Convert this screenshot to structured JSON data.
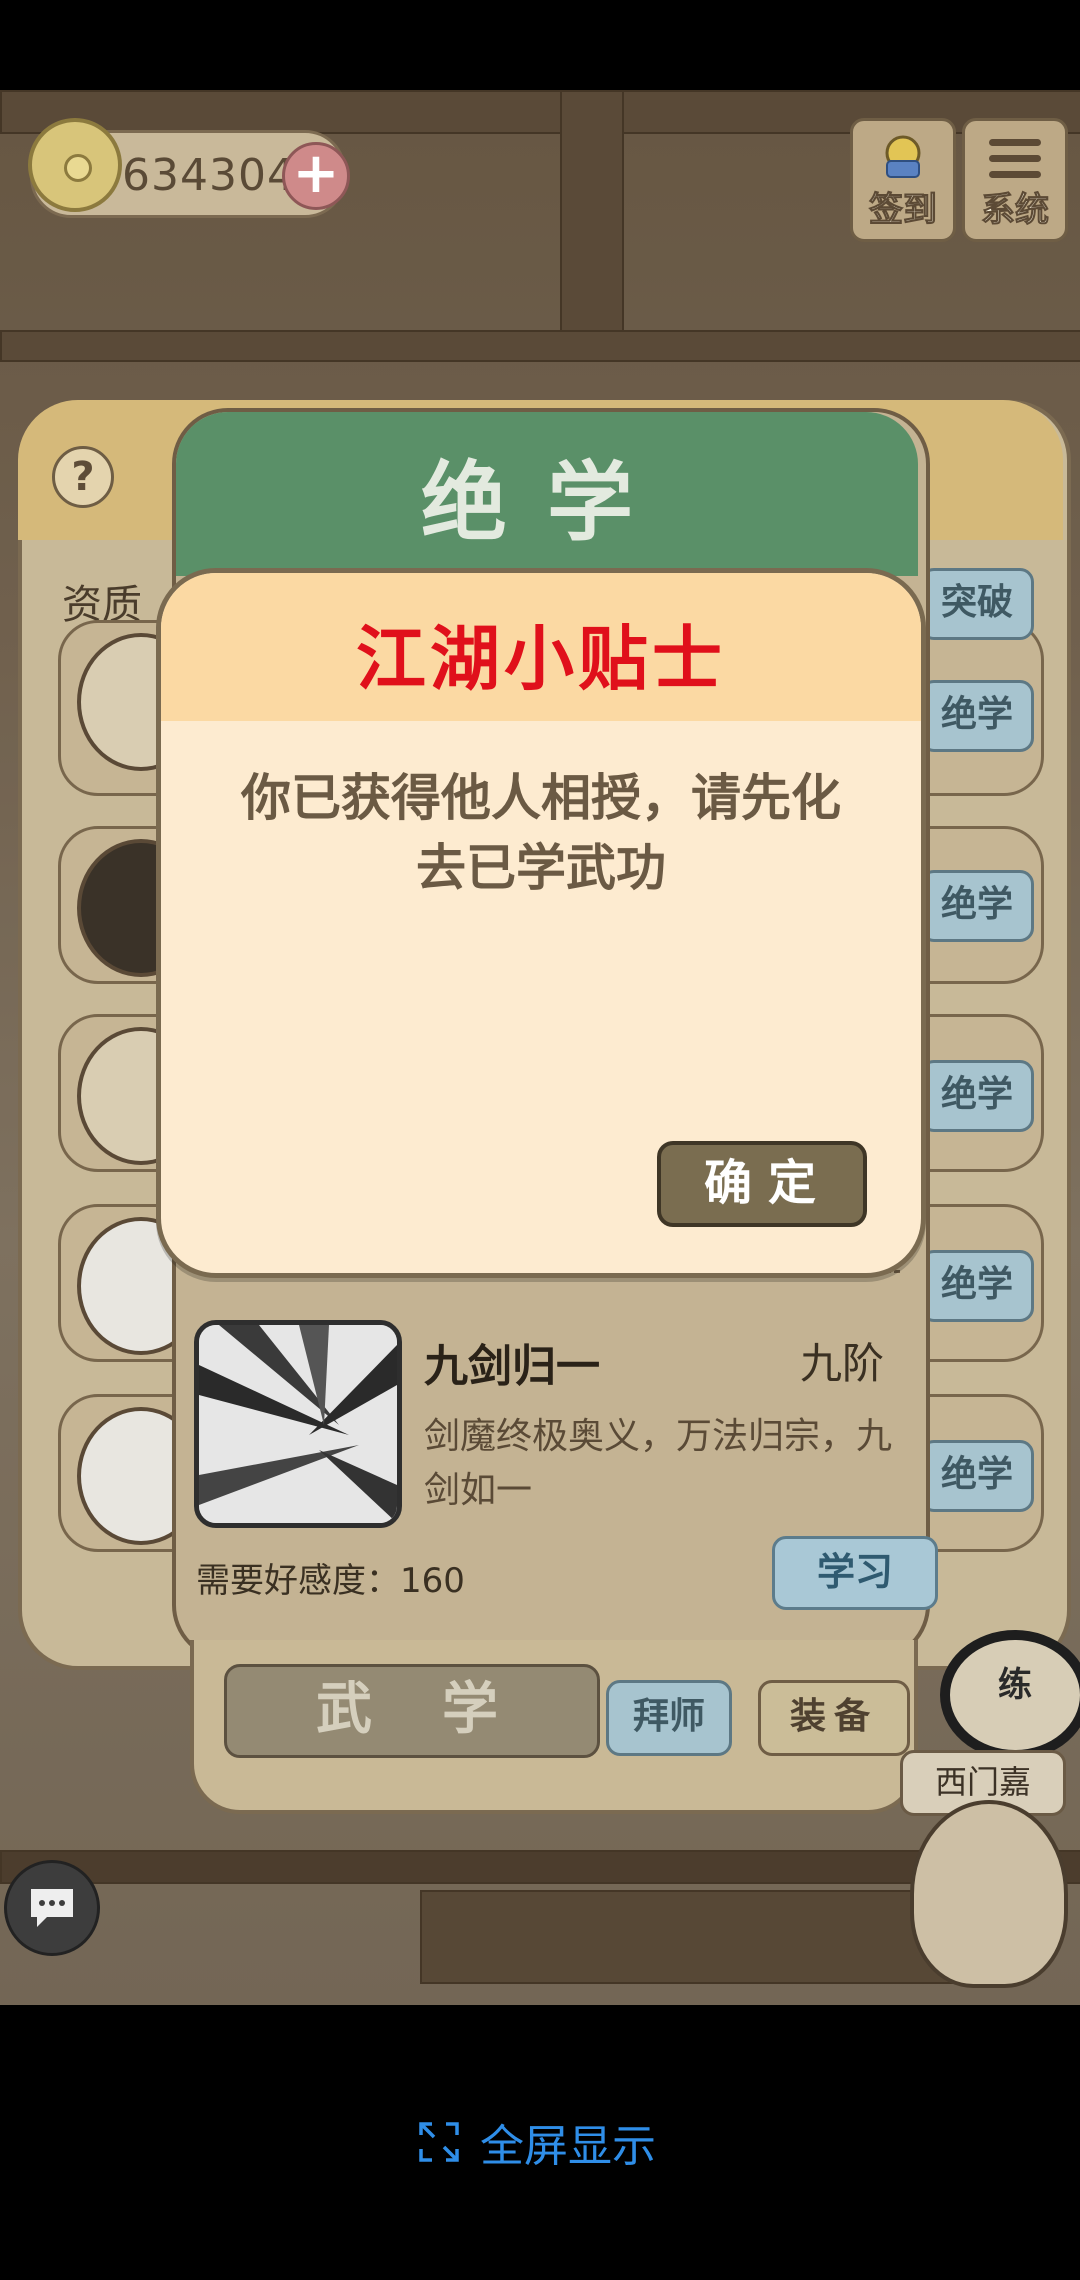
{
  "hud": {
    "coins": "634304",
    "plus_symbol": "+",
    "signin_label": "签到",
    "system_label": "系统"
  },
  "back_panel": {
    "help_symbol": "?",
    "quality_label": "资质",
    "side_buttons": [
      "突破",
      "绝学",
      "绝学",
      "绝学",
      "绝学",
      "绝学"
    ]
  },
  "skill_panel": {
    "title": "绝学",
    "skill_name": "九剑归一",
    "skill_rank": "九阶",
    "skill_desc": "剑魔终极奥义，万法归宗，九剑如一",
    "affinity_label": "需要好感度：160",
    "learn_label": "学习"
  },
  "tabs": {
    "wuxue": "武学",
    "baishi": "拜师",
    "zhuangbei": "装备"
  },
  "npc": {
    "badge": "练",
    "name": "西门嘉"
  },
  "dialog": {
    "title": "江湖小贴士",
    "message": "你已获得他人相授，请先化去已学武功",
    "confirm_label": "确定"
  },
  "system_bar": {
    "fullscreen_label": "全屏显示"
  },
  "colors": {
    "header_green": "#5a9068",
    "dialog_title_red": "#e0101b",
    "link_blue": "#2f8ee8"
  }
}
